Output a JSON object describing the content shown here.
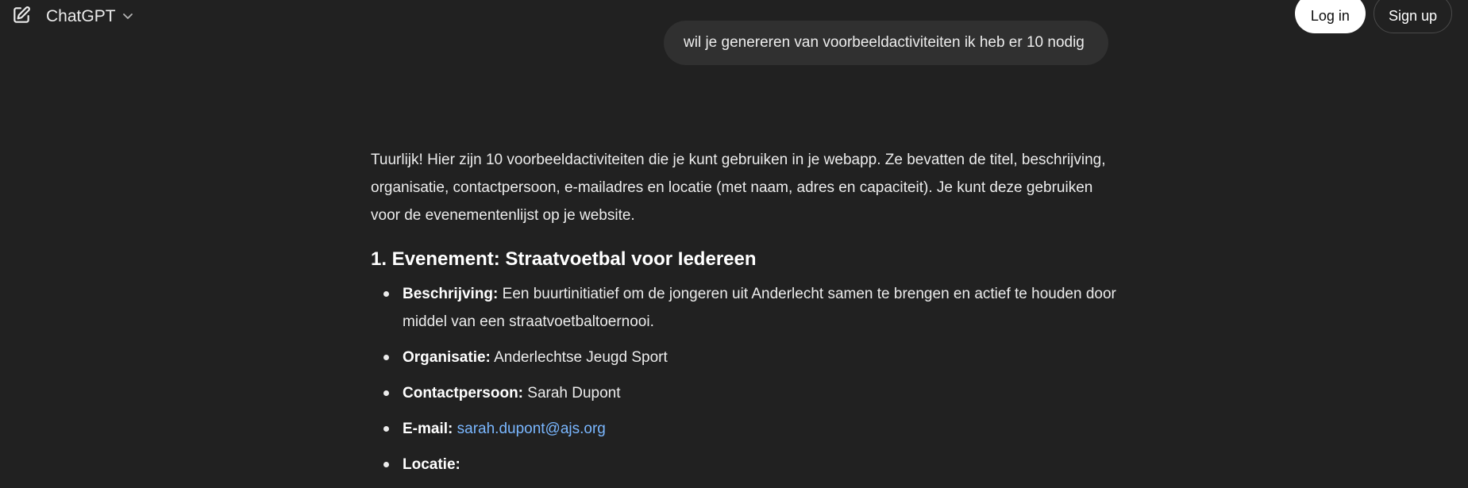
{
  "header": {
    "model_label": "ChatGPT",
    "login_label": "Log in",
    "signup_label": "Sign up"
  },
  "conversation": {
    "user_message": "wil je genereren van voorbeeldactiviteiten ik heb er 10 nodig",
    "assistant_intro": "Tuurlijk! Hier zijn 10 voorbeeldactiviteiten die je kunt gebruiken in je webapp. Ze bevatten de titel, beschrijving, organisatie, contactpersoon, e-mailadres en locatie (met naam, adres en capaciteit). Je kunt deze gebruiken voor de evenementenlijst op je website.",
    "event_heading": "1. Evenement: Straatvoetbal voor Iedereen",
    "details": [
      {
        "label": "Beschrijving:",
        "value": " Een buurtinitiatief om de jongeren uit Anderlecht samen te brengen en actief te houden door middel van een straatvoetbaltoernooi."
      },
      {
        "label": "Organisatie:",
        "value": " Anderlechtse Jeugd Sport"
      },
      {
        "label": "Contactpersoon:",
        "value": " Sarah Dupont"
      },
      {
        "label": "E-mail:",
        "value": "sarah.dupont@ajs.org"
      },
      {
        "label": "Locatie:",
        "value": ""
      }
    ]
  },
  "colors": {
    "background": "#212121",
    "user_bubble": "#303030",
    "link": "#7ab7ff"
  },
  "icons": {
    "new_chat": "compose-icon",
    "model_dropdown": "chevron-down-icon"
  }
}
